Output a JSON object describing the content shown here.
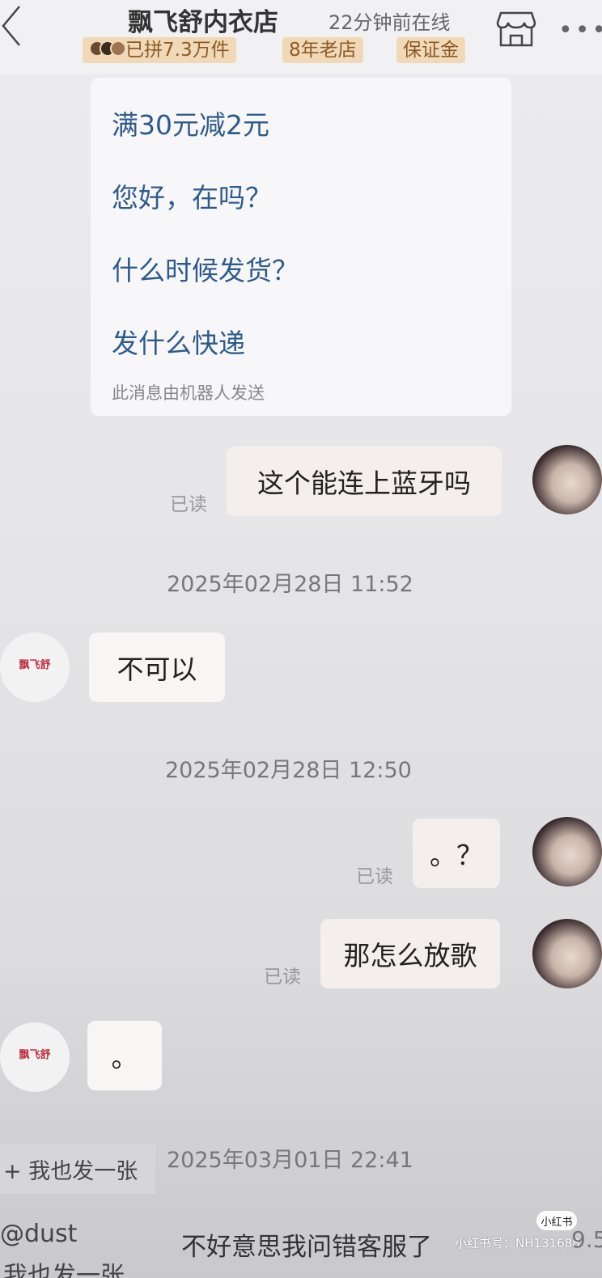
{
  "header": {
    "shop_name": "飘飞舒内衣店",
    "online_status": "22分钟前在线",
    "badges": [
      "已拼7.3万件",
      "8年老店",
      "保证金"
    ]
  },
  "bot_card": {
    "questions": [
      "满30元减2元",
      "您好，在吗？",
      "什么时候发货？",
      "发什么快递"
    ],
    "note": "此消息由机器人发送"
  },
  "messages": [
    {
      "sender": "user",
      "text": "这个能连上蓝牙吗",
      "read": "已读"
    },
    {
      "timestamp": "2025年02月28日 11:52"
    },
    {
      "sender": "shop",
      "text": "不可以"
    },
    {
      "timestamp": "2025年02月28日 12:50"
    },
    {
      "sender": "user",
      "text": "。？",
      "read": "已读"
    },
    {
      "sender": "user",
      "text": "那怎么放歌",
      "read": "已读"
    },
    {
      "sender": "shop",
      "text": "。"
    },
    {
      "timestamp": "2025年03月01日 22:41"
    },
    {
      "sender": "user",
      "text": "不好意思我问错客服了"
    }
  ],
  "shop_avatar_label": "飘飞舒",
  "overlay": {
    "share_button": "+ 我也发一张",
    "comment_user": "@dust",
    "comment_partial": "我也发一张"
  },
  "watermark": {
    "badge": "小红书",
    "text": "小红书号：NH131688"
  },
  "page_number": "9.5"
}
